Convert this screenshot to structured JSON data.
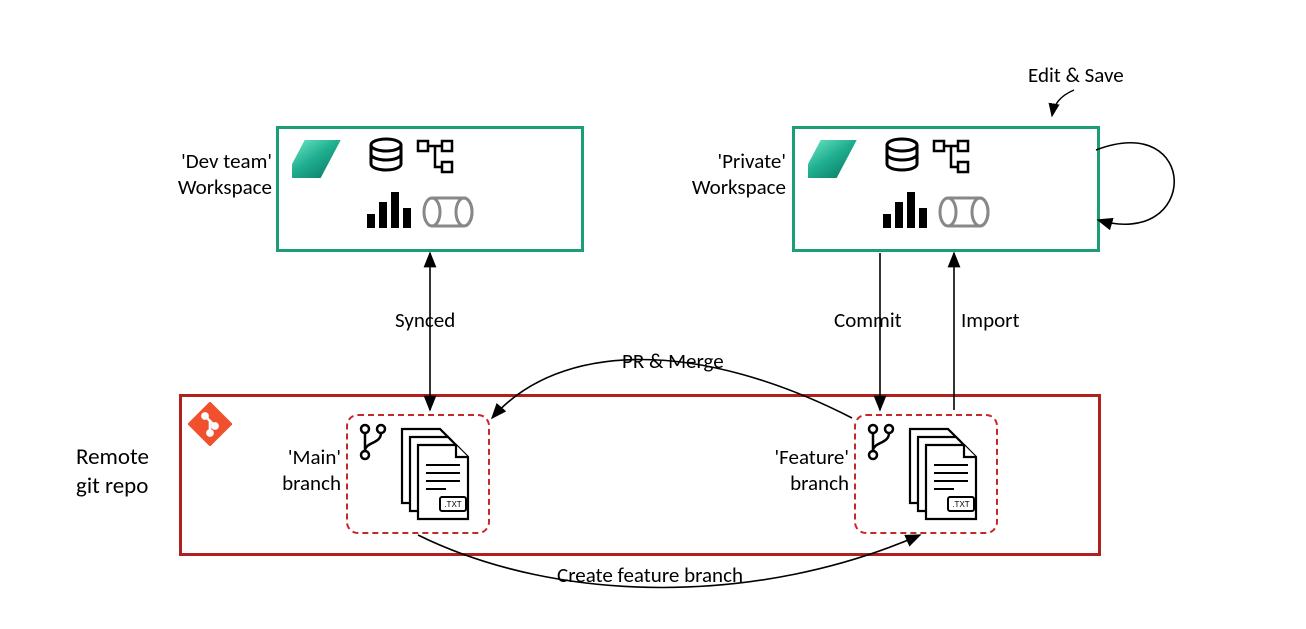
{
  "labels": {
    "dev_team": "'Dev team'",
    "workspace1": "Workspace",
    "private": "'Private'",
    "workspace2": "Workspace",
    "synced": "Synced",
    "commit": "Commit",
    "import": "Import",
    "pr_merge": "PR & Merge",
    "edit_save": "Edit & Save",
    "create_feature": "Create feature branch",
    "remote": "Remote",
    "git_repo": "git repo",
    "main_branch1": "'Main'",
    "main_branch2": "branch",
    "feature_branch1": "'Feature'",
    "feature_branch2": "branch"
  },
  "diagram": {
    "nodes": [
      {
        "id": "dev-workspace",
        "type": "workspace",
        "label": "'Dev team' Workspace",
        "color": "teal"
      },
      {
        "id": "private-workspace",
        "type": "workspace",
        "label": "'Private' Workspace",
        "color": "teal"
      },
      {
        "id": "remote-repo",
        "type": "repo",
        "label": "Remote git repo",
        "color": "red"
      },
      {
        "id": "main-branch",
        "type": "branch",
        "label": "'Main' branch",
        "parent": "remote-repo"
      },
      {
        "id": "feature-branch",
        "type": "branch",
        "label": "'Feature' branch",
        "parent": "remote-repo"
      }
    ],
    "edges": [
      {
        "from": "dev-workspace",
        "to": "main-branch",
        "label": "Synced",
        "direction": "both"
      },
      {
        "from": "private-workspace",
        "to": "feature-branch",
        "label": "Commit",
        "direction": "down"
      },
      {
        "from": "feature-branch",
        "to": "private-workspace",
        "label": "Import",
        "direction": "up"
      },
      {
        "from": "main-branch",
        "to": "feature-branch",
        "label": "Create feature branch",
        "direction": "right"
      },
      {
        "from": "feature-branch",
        "to": "main-branch",
        "label": "PR & Merge",
        "direction": "left"
      },
      {
        "from": "private-workspace",
        "to": "private-workspace",
        "label": "Edit & Save",
        "direction": "loop"
      }
    ]
  }
}
